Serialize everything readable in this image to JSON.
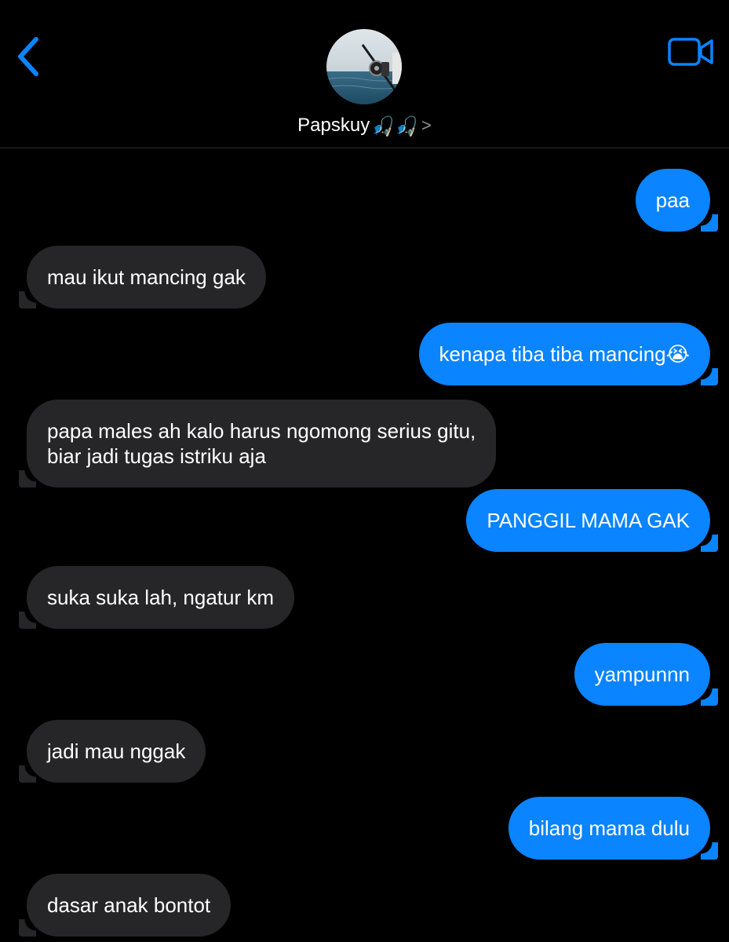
{
  "theme": {
    "background": "#000000",
    "accent": "#0a84ff",
    "sent_bubble": "#0a84ff",
    "received_bubble": "#262628"
  },
  "header": {
    "back_icon": "chevron-left-icon",
    "video_icon": "video-camera-icon",
    "contact_name": "Papskuy",
    "contact_emoji": "🎣🎣",
    "contact_chevron": ">"
  },
  "messages": [
    {
      "direction": "sent",
      "text": "paa"
    },
    {
      "direction": "received",
      "text": "mau ikut mancing gak"
    },
    {
      "direction": "sent",
      "text": "kenapa tiba tiba mancing😭"
    },
    {
      "direction": "received",
      "text": "papa males ah kalo harus ngomong serius gitu,\nbiar jadi tugas istriku aja"
    },
    {
      "direction": "sent",
      "text": "PANGGIL MAMA GAK"
    },
    {
      "direction": "received",
      "text": "suka suka lah, ngatur km"
    },
    {
      "direction": "sent",
      "text": "yampunnn"
    },
    {
      "direction": "received",
      "text": "jadi mau nggak"
    },
    {
      "direction": "sent",
      "text": "bilang mama dulu"
    },
    {
      "direction": "received",
      "text": "dasar anak bontot"
    }
  ]
}
